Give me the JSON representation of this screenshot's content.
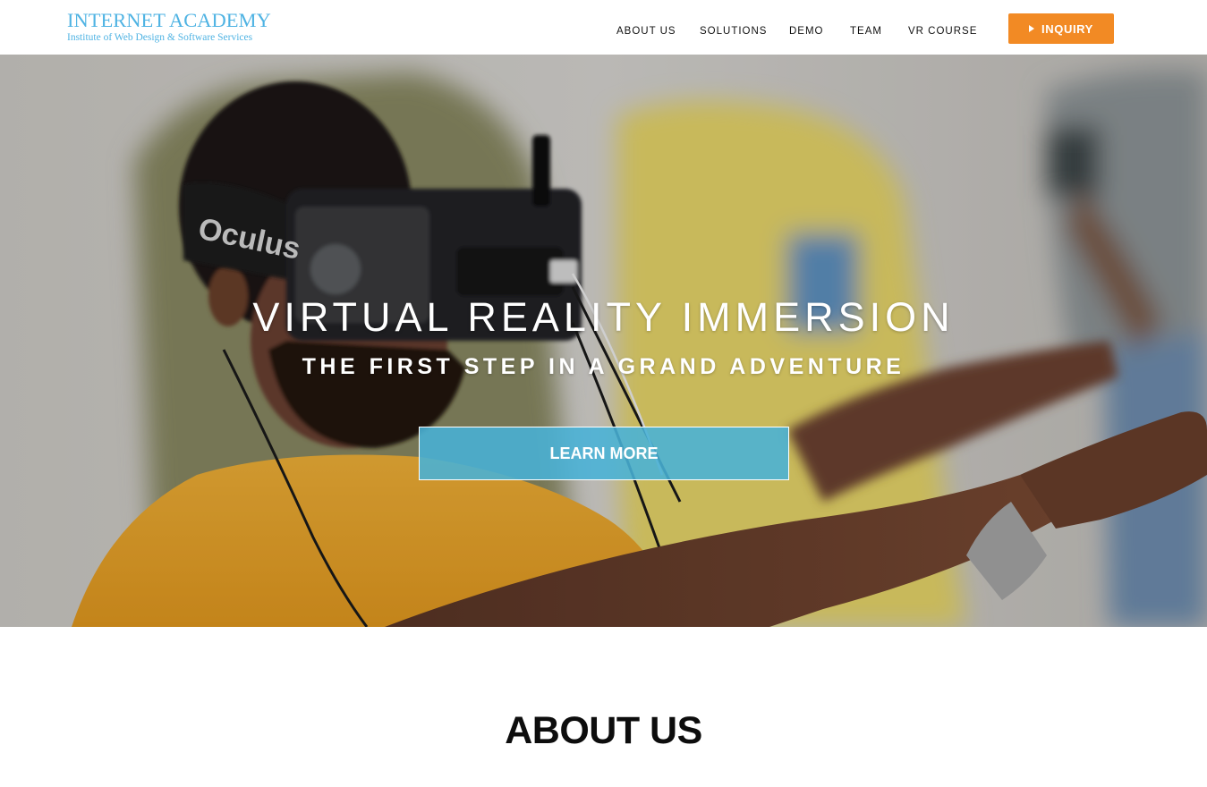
{
  "header": {
    "logo": {
      "title": "INTERNET ACADEMY",
      "subtitle": "Institute of Web Design & Software Services"
    },
    "nav": [
      {
        "label": "ABOUT US"
      },
      {
        "label": "SOLUTIONS"
      },
      {
        "label": "DEMO"
      },
      {
        "label": "TEAM"
      },
      {
        "label": "VR COURSE"
      }
    ],
    "inquiry_label": "INQUIRY"
  },
  "hero": {
    "title": "VIRTUAL REALITY IMMERSION",
    "subtitle": "THE FIRST STEP IN A GRAND ADVENTURE",
    "button_label": "LEARN MORE"
  },
  "about": {
    "heading": "ABOUT US"
  },
  "colors": {
    "brand_blue": "#4fb3e3",
    "inquiry_orange": "#f28a24",
    "learn_button_blue": "#48b2d7",
    "nav_text": "#111111"
  },
  "icons": {
    "inquiry": "play-icon"
  }
}
